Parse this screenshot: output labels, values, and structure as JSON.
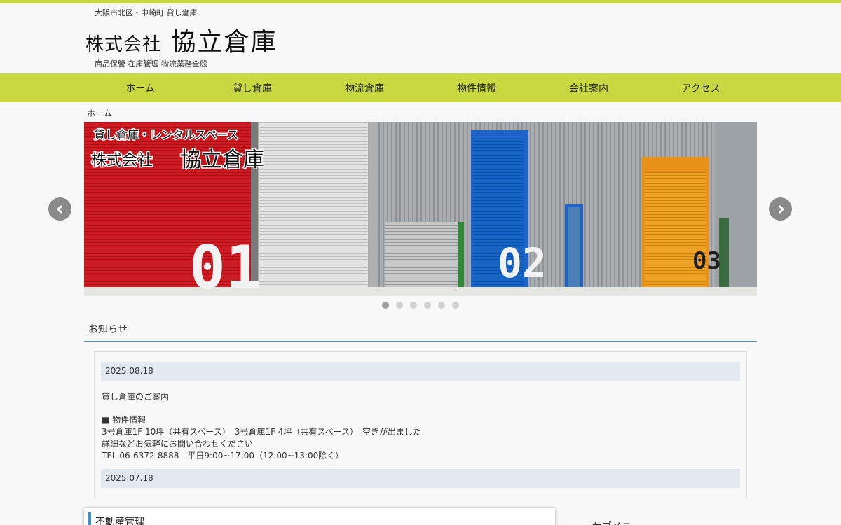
{
  "header": {
    "tagline": "大阪市北区・中崎町 貸し倉庫",
    "logo_small": "株式会社",
    "logo_main": "協立倉庫",
    "subtag": "商品保管 在庫管理 物流業務全般"
  },
  "nav": {
    "items": [
      "ホーム",
      "貸し倉庫",
      "物流倉庫",
      "物件情報",
      "会社案内",
      "アクセス"
    ]
  },
  "breadcrumb": "ホーム",
  "slider": {
    "overlay_line1": "貸し倉庫・レンタルスペース",
    "overlay_small": "株式会社",
    "overlay_main": "協立倉庫",
    "door_numbers": [
      "01",
      "02",
      "03"
    ],
    "dot_count": 6,
    "active_dot": 1
  },
  "news": {
    "heading": "お知らせ",
    "entries": [
      {
        "date": "2025.08.18",
        "title": "貸し倉庫のご案内",
        "lines": [
          "■ 物件情報",
          "3号倉庫1F 10坪（共有スペース）　3号倉庫1F 4坪（共有スペース）　空きが出ました",
          "詳細などお気軽にお問い合わせください",
          "TEL 06-6372-8888　平日9:00~17:00（12:00~13:00除く）"
        ]
      },
      {
        "date": "2025.07.18"
      }
    ]
  },
  "panel": {
    "title": "不動産管理"
  },
  "sidebar": {
    "title": "サブメニュー"
  },
  "colors": {
    "accent": "#c8d840",
    "heading_rule": "#4a8fc0",
    "date_bg": "#e2e8ef"
  }
}
